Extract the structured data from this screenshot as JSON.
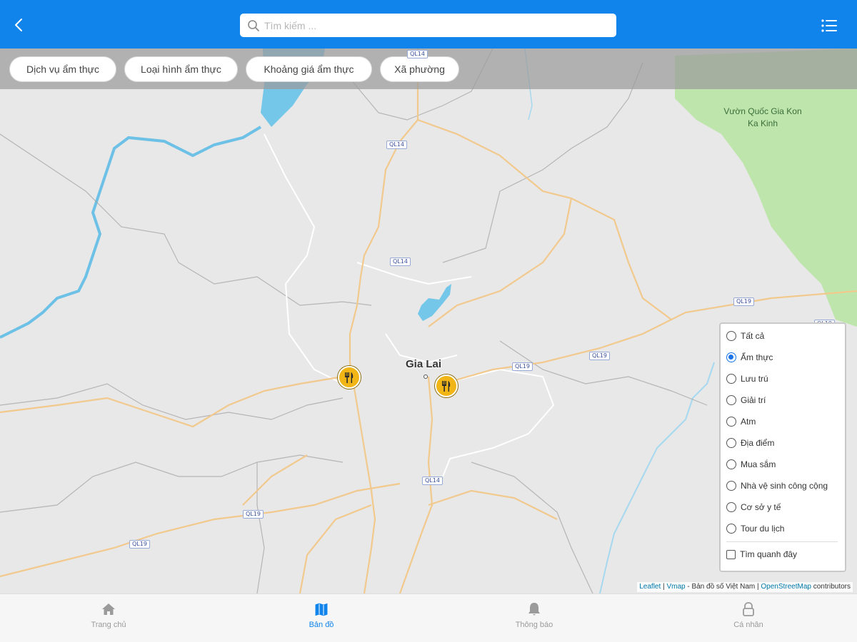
{
  "colors": {
    "header_bg": "#1184ec",
    "active_nav": "#1184ec",
    "inactive_nav": "#9b9b9b",
    "marker": "#f1b616",
    "park": "#b9e4a4",
    "water": "#75c7ea",
    "road": "#f2c98d"
  },
  "header": {
    "search_placeholder": "Tìm kiếm ...",
    "back_icon": "chevron-left-icon",
    "menu_icon": "list-menu-icon"
  },
  "filters": [
    {
      "label": "Dịch vụ ẩm thực"
    },
    {
      "label": "Loại hình ẩm thực"
    },
    {
      "label": "Khoảng giá ẩm thực"
    },
    {
      "label": "Xã phường"
    }
  ],
  "map": {
    "city_label": "Gia Lai",
    "park_label": "Vườn Quốc Gia Kon Ka Kinh",
    "road_shields": [
      "QL14",
      "QL14",
      "QL14",
      "QL14",
      "QL19",
      "QL19",
      "QL19",
      "QL19",
      "QL19",
      "QL19"
    ],
    "markers": [
      {
        "icon": "restaurant-icon",
        "category": "Ẩm thực"
      },
      {
        "icon": "restaurant-icon",
        "category": "Ẩm thực"
      }
    ],
    "layers": {
      "options": [
        {
          "label": "Tất cả",
          "checked": false
        },
        {
          "label": "Ẩm thực",
          "checked": true
        },
        {
          "label": "Lưu trú",
          "checked": false
        },
        {
          "label": "Giải trí",
          "checked": false
        },
        {
          "label": "Atm",
          "checked": false
        },
        {
          "label": "Địa điểm",
          "checked": false
        },
        {
          "label": "Mua sắm",
          "checked": false
        },
        {
          "label": "Nhà vệ sinh công cộng",
          "checked": false
        },
        {
          "label": "Cơ sở y tế",
          "checked": false
        },
        {
          "label": "Tour du lịch",
          "checked": false
        }
      ],
      "nearby": {
        "label": "Tìm quanh đây",
        "checked": false
      }
    },
    "attribution": {
      "leaflet": "Leaflet",
      "sep1": " | ",
      "vmap": "Vmap",
      "text": " - Bản đồ số Việt Nam | ",
      "osm": "OpenStreetMap",
      "suffix": " contributors"
    }
  },
  "bottom_nav": [
    {
      "label": "Trang chủ",
      "icon": "home-icon",
      "active": false
    },
    {
      "label": "Bản đồ",
      "icon": "map-icon",
      "active": true
    },
    {
      "label": "Thông báo",
      "icon": "bell-icon",
      "active": false
    },
    {
      "label": "Cá nhân",
      "icon": "lock-icon",
      "active": false
    }
  ]
}
